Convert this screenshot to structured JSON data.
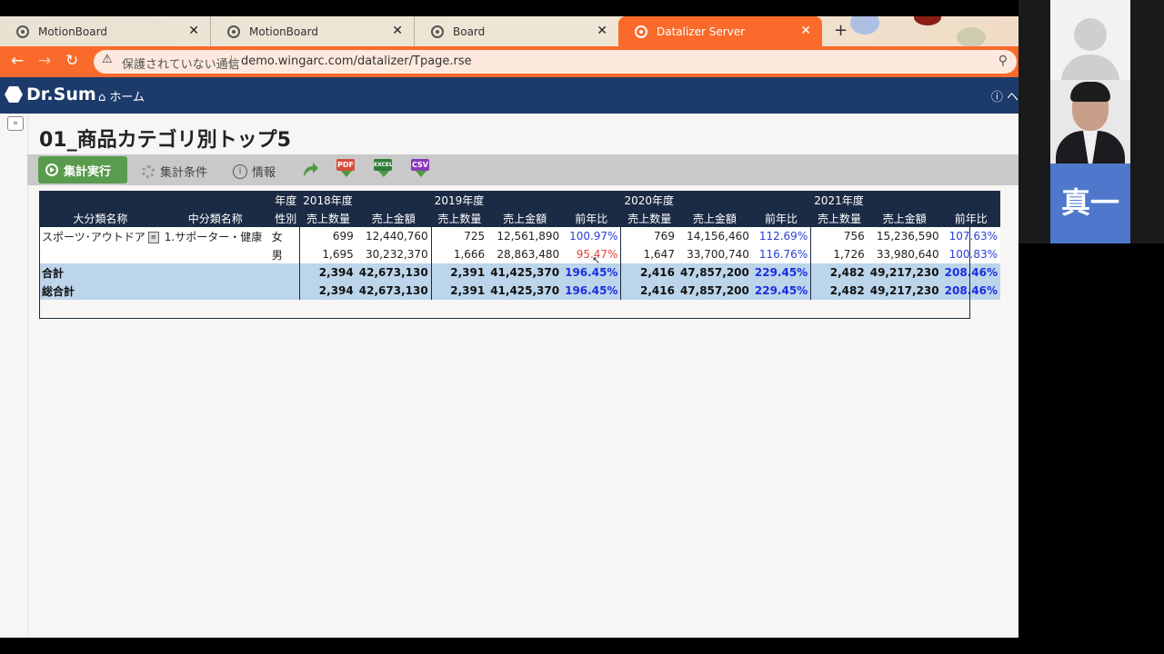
{
  "browser": {
    "tabs": [
      {
        "label": "MotionBoard",
        "active": false
      },
      {
        "label": "MotionBoard",
        "active": false
      },
      {
        "label": "Board",
        "active": false
      },
      {
        "label": "Datalizer Server",
        "active": true
      }
    ],
    "new_tab_glyph": "+",
    "close_glyph": "✕",
    "not_secure": "保護されていない通信",
    "url": "demo.wingarc.com/datalizer/Tpage.rse",
    "accent_color": "#fa6a2b"
  },
  "app": {
    "logo_text": "Dr.Sum",
    "home_label": "ホーム",
    "help_label": "ヘ",
    "header_color": "#1c3a6a"
  },
  "page": {
    "title": "01_商品カテゴリ別トップ5",
    "toolbar": {
      "run_label": "集計実行",
      "conditions_label": "集計条件",
      "info_label": "情報",
      "pdf_label": "PDF",
      "excel_label": "EXCEL",
      "csv_label": "CSV"
    }
  },
  "table": {
    "header_year_label": "年度",
    "header_gender_label": "性別",
    "col_major": "大分類名称",
    "col_middle": "中分類名称",
    "years": [
      "2018年度",
      "2019年度",
      "2020年度",
      "2021年度"
    ],
    "qty_label": "売上数量",
    "amount_label": "売上金額",
    "yoy_label": "前年比",
    "rows": [
      {
        "major": "スポーツ･アウトドア",
        "middle": "1.サポーター・健康",
        "gender": "女",
        "y2018": {
          "qty": "699",
          "amount": "12,440,760"
        },
        "y2019": {
          "qty": "725",
          "amount": "12,561,890",
          "yoy": "100.97%"
        },
        "y2020": {
          "qty": "769",
          "amount": "14,156,460",
          "yoy": "112.69%"
        },
        "y2021": {
          "qty": "756",
          "amount": "15,236,590",
          "yoy": "107.63%"
        }
      },
      {
        "major": "",
        "middle": "",
        "gender": "男",
        "y2018": {
          "qty": "1,695",
          "amount": "30,232,370"
        },
        "y2019": {
          "qty": "1,666",
          "amount": "28,863,480",
          "yoy": "95.47%"
        },
        "y2020": {
          "qty": "1,647",
          "amount": "33,700,740",
          "yoy": "116.76%"
        },
        "y2021": {
          "qty": "1,726",
          "amount": "33,980,640",
          "yoy": "100.83%"
        }
      }
    ],
    "subtotal": {
      "label": "合計",
      "y2018": {
        "qty": "2,394",
        "amount": "42,673,130"
      },
      "y2019": {
        "qty": "2,391",
        "amount": "41,425,370",
        "yoy": "196.45%"
      },
      "y2020": {
        "qty": "2,416",
        "amount": "47,857,200",
        "yoy": "229.45%"
      },
      "y2021": {
        "qty": "2,482",
        "amount": "49,217,230",
        "yoy": "208.46%"
      }
    },
    "grandtotal": {
      "label": "総合計",
      "y2018": {
        "qty": "2,394",
        "amount": "42,673,130"
      },
      "y2019": {
        "qty": "2,391",
        "amount": "41,425,370",
        "yoy": "196.45%"
      },
      "y2020": {
        "qty": "2,416",
        "amount": "47,857,200",
        "yoy": "229.45%"
      },
      "y2021": {
        "qty": "2,482",
        "amount": "49,217,230",
        "yoy": "208.46%"
      }
    }
  },
  "video": {
    "name_tile_text": "真一"
  }
}
